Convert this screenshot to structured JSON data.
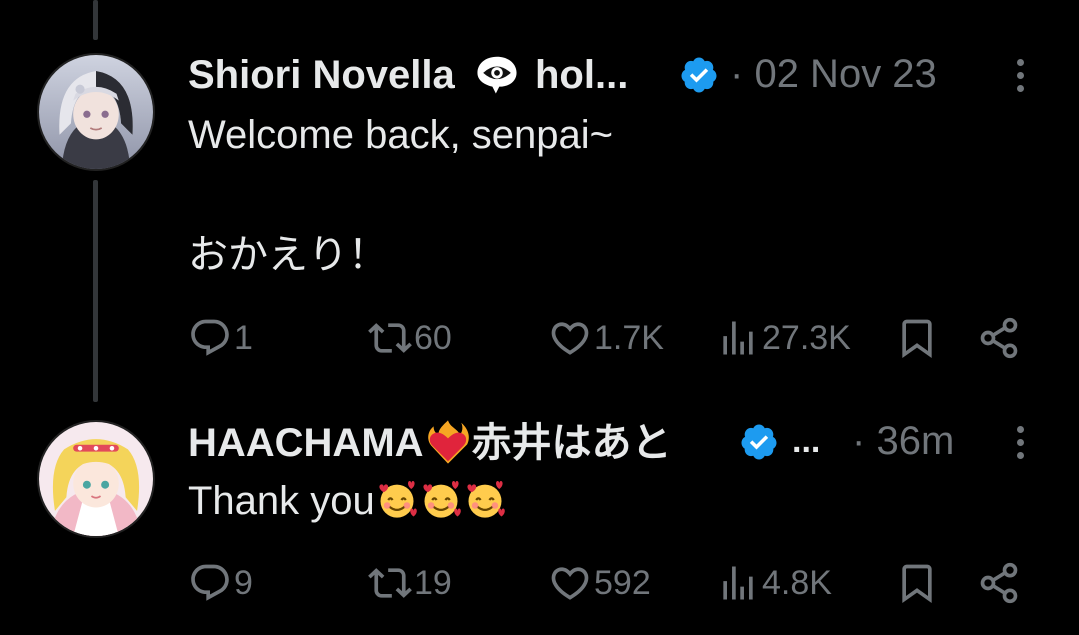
{
  "tweets": [
    {
      "author": "Shiori Novella",
      "author_suffix": "hol...",
      "name_emoji_icon": "eye-in-speech-bubble-icon",
      "verified": true,
      "separator": "·",
      "timestamp": "02 Nov 23",
      "text_lines": [
        "Welcome back, senpai~",
        "おかえり！"
      ],
      "replies": "1",
      "retweets": "60",
      "likes": "1.7K",
      "views": "27.3K"
    },
    {
      "author": "HAACHAMA",
      "name_emoji_icon": "heart-on-fire-icon",
      "author_suffix": "赤井はあと",
      "verified": true,
      "ellipsis": "...",
      "separator": "·",
      "timestamp": "36m",
      "text": "Thank you",
      "text_emoji_icons": [
        "smiling-face-with-hearts-icon",
        "smiling-face-with-hearts-icon",
        "smiling-face-with-hearts-icon"
      ],
      "replies": "9",
      "retweets": "19",
      "likes": "592",
      "views": "4.8K"
    }
  ],
  "colors": {
    "background": "#000000",
    "text_primary": "#e7e9ea",
    "text_secondary": "#71767b",
    "verified_blue": "#1d9bf0",
    "thread_line": "#333639"
  }
}
